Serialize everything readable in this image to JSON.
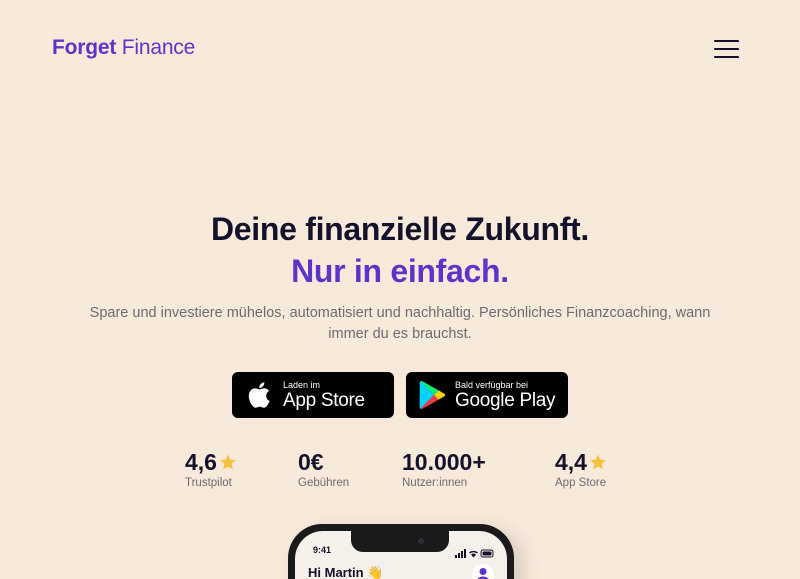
{
  "brand": {
    "name_bold": "Forget",
    "name_rest": "Finance"
  },
  "header": {
    "menu_icon": "hamburger-menu-icon"
  },
  "hero": {
    "title_line1": "Deine finanzielle Zukunft.",
    "title_line2": "Nur in einfach.",
    "subtitle": "Spare und investiere mühelos, automatisiert und nachhaltig. Persönliches Finanzcoaching, wann immer du es brauchst."
  },
  "stores": {
    "apple": {
      "small": "Laden im",
      "big": "App Store",
      "icon": "apple-icon"
    },
    "google": {
      "small": "Bald verfügbar bei",
      "big": "Google Play",
      "icon": "google-play-icon"
    }
  },
  "stats": [
    {
      "value": "4,6",
      "label": "Trustpilot",
      "star": true
    },
    {
      "value": "0€",
      "label": "Gebühren",
      "star": false
    },
    {
      "value": "10.000+",
      "label": "Nutzer:innen",
      "star": false
    },
    {
      "value": "4,4",
      "label": "App Store",
      "star": true
    }
  ],
  "phone": {
    "time": "9:41",
    "greeting": "Hi Martin 👋"
  },
  "colors": {
    "background": "#f8eadb",
    "accent": "#5b35c9",
    "text": "#14112b",
    "star": "#f6c23d"
  }
}
